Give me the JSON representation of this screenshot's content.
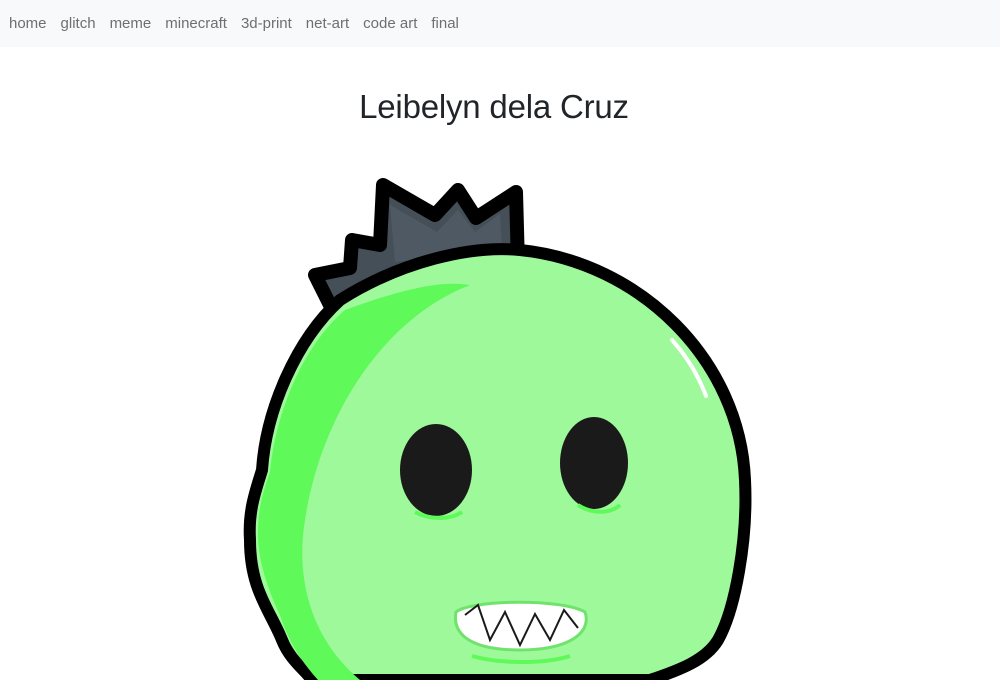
{
  "nav": {
    "items": [
      {
        "label": "home"
      },
      {
        "label": "glitch"
      },
      {
        "label": "meme"
      },
      {
        "label": "minecraft"
      },
      {
        "label": "3d-print"
      },
      {
        "label": "net-art"
      },
      {
        "label": "code art"
      },
      {
        "label": "final"
      }
    ]
  },
  "header": {
    "title": "Leibelyn dela Cruz"
  },
  "colors": {
    "nav_background": "#f8f9fa",
    "nav_link": "#6c6f73",
    "title": "#212529",
    "slime_body": "#9ef99b",
    "slime_shade": "#5ff95a",
    "crown": "#454f57",
    "outline": "#000000"
  },
  "image": {
    "subject": "green-slime-monster-with-crown"
  }
}
